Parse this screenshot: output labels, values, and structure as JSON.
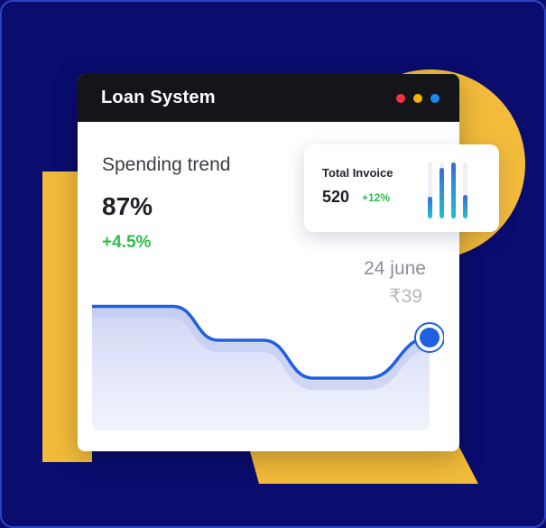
{
  "app": {
    "title": "Loan System",
    "window_dots": [
      "#ef3340",
      "#f4b400",
      "#1e88f5"
    ]
  },
  "spending": {
    "label": "Spending trend",
    "percent": "87%",
    "change": "+4.5%"
  },
  "tooltip": {
    "date": "24 june",
    "amount": "₹39"
  },
  "invoice": {
    "title": "Total Invoice",
    "value": "520",
    "change": "+12%",
    "bars": [
      0.38,
      0.9,
      1.0,
      0.42
    ]
  },
  "chart_data": {
    "type": "line",
    "series": [
      {
        "values": [
          0.85,
          0.85,
          0.6,
          0.6,
          0.32,
          0.32,
          0.62
        ]
      }
    ]
  },
  "colors": {
    "background": "#0a0c6e",
    "accent_yellow": "#f2bb3a",
    "line_blue": "#1f5fe0",
    "positive_green": "#2bbf4a"
  }
}
